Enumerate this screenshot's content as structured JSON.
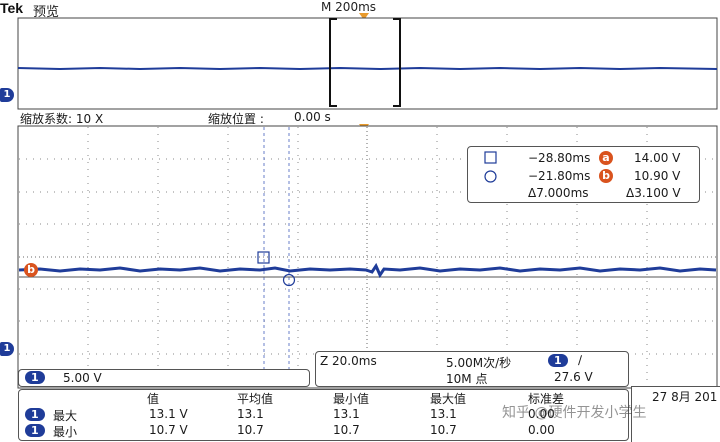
{
  "header": {
    "brand": "Tek",
    "mode": "预览",
    "timebase": "M 200ms"
  },
  "zoom": {
    "factor_label": "缩放系数: 10 X",
    "position_label": "缩放位置 :",
    "position_value": "0.00 s"
  },
  "cursors": {
    "square_time": "−28.80ms",
    "circle_time": "−21.80ms",
    "delta_time": "Δ7.000ms",
    "a_label": "a",
    "a_value": "14.00 V",
    "b_label": "b",
    "b_value": "10.90 V",
    "delta_volt": "Δ3.100 V"
  },
  "ch_markers": {
    "ch1": "1",
    "ref_b": "b"
  },
  "status": {
    "ch1_badge": "1",
    "ch1_scale": "5.00 V",
    "zoom_scale": "Z 20.0ms",
    "sample_rate": "5.00M次/秒",
    "record_length": "10M 点",
    "trig_badge": "1",
    "trig_slope": "∕",
    "trig_level": "27.6 V",
    "date": "27 8月 201"
  },
  "measurements": {
    "headers": [
      "值",
      "平均值",
      "最小值",
      "最大值",
      "标准差"
    ],
    "rows": [
      {
        "ch": "1",
        "name": "最大",
        "value": "13.1 V",
        "mean": "13.1",
        "min": "13.1",
        "max": "13.1",
        "std": "0.00"
      },
      {
        "ch": "1",
        "name": "最小",
        "value": "10.7 V",
        "mean": "10.7",
        "min": "10.7",
        "max": "10.7",
        "std": "0.00"
      }
    ]
  },
  "watermark": "知乎 @硬件开发小学生",
  "colors": {
    "trace": "#1f3c99",
    "cursor": "#6a7fc9",
    "accent": "#d9531e",
    "trigger": "#e89a2c",
    "grid": "#8a8a8a"
  }
}
